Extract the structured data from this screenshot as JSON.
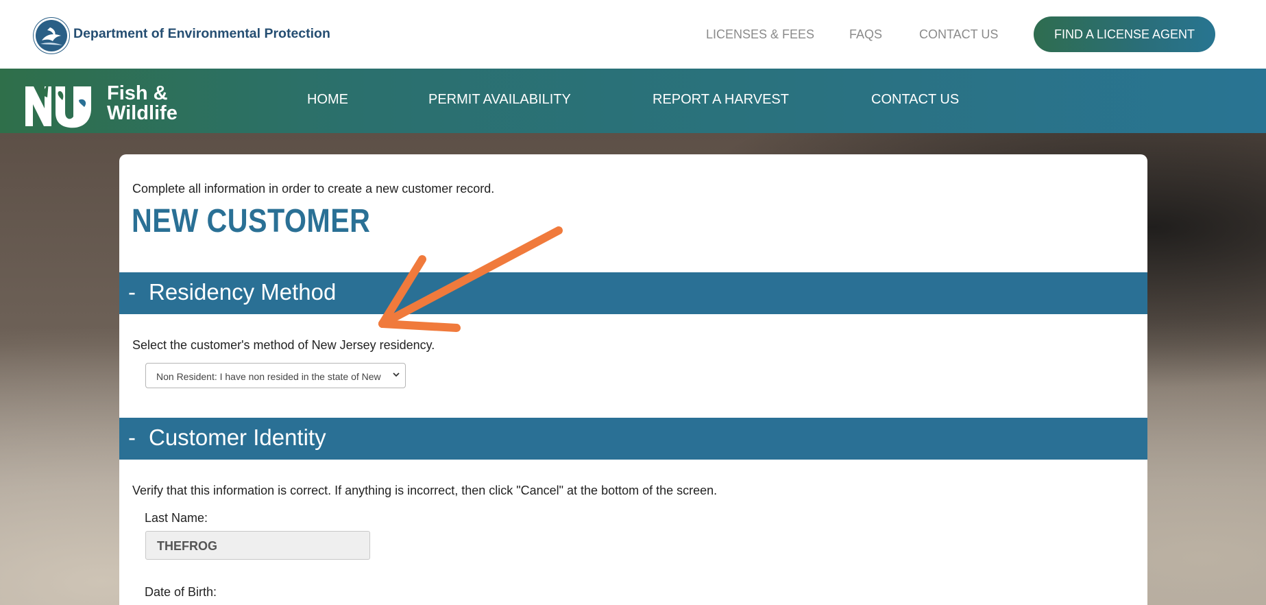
{
  "header": {
    "department_name": "Department of Environmental Protection",
    "links": [
      "LICENSES & FEES",
      "FAQS",
      "CONTACT US"
    ],
    "cta_label": "FIND A LICENSE AGENT"
  },
  "nav": {
    "logo_line1": "Fish &",
    "logo_line2": "Wildlife",
    "items": [
      "HOME",
      "PERMIT AVAILABILITY",
      "REPORT A HARVEST",
      "CONTACT US"
    ]
  },
  "main": {
    "intro": "Complete all information in order to create a new customer record.",
    "title": "NEW CUSTOMER",
    "residency": {
      "toggle": "-",
      "heading": "Residency Method",
      "help": "Select the customer's method of New Jersey residency.",
      "selected": "Non Resident: I have non resided in the state of New"
    },
    "identity": {
      "toggle": "-",
      "heading": "Customer Identity",
      "help": "Verify that this information is correct. If anything is incorrect, then click \"Cancel\" at the bottom of the screen.",
      "last_name_label": "Last Name:",
      "last_name_value": "THEFROG",
      "dob_label": "Date of Birth:"
    }
  },
  "colors": {
    "brand_blue": "#2a7095",
    "brand_green": "#2f6f4a",
    "annotation_arrow": "#f07a3c"
  }
}
